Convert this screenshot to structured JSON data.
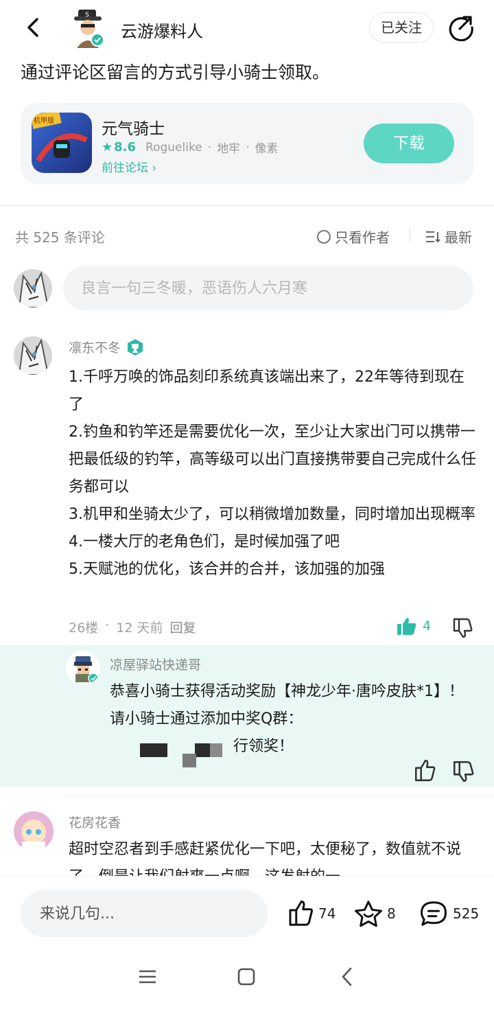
{
  "header": {
    "author_name": "云游爆料人",
    "follow_label": "已关注"
  },
  "post": {
    "text": "通过评论区留言的方式引导小骑士领取。"
  },
  "game_card": {
    "name": "元气骑士",
    "rating": "8.6",
    "tags": [
      "Roguelike",
      "地牢",
      "像素"
    ],
    "forum_link": "前往论坛",
    "download_label": "下载",
    "icon_badge": "机甲版",
    "accent_color": "#2dbba6",
    "download_color": "#5ed6c4"
  },
  "comments_bar": {
    "count_text": "共 525 条评论",
    "only_author_label": "只看作者",
    "sort_label": "最新"
  },
  "comment_input": {
    "placeholder": "良言一句三冬暖，恶语伤人六月寒"
  },
  "comments": [
    {
      "user": "凛东不冬",
      "lines": [
        "1.千呼万唤的饰品刻印系统真该端出来了，22年等待到现在了",
        "2.钓鱼和钓竿还是需要优化一次，至少让大家出门可以携带一把最低级的钓竿，高等级可以出门直接携带要自己完成什么任务都可以",
        "3.机甲和坐骑太少了，可以稍微增加数量，同时增加出现概率",
        "4.一楼大厅的老角色们，是时候加强了吧",
        "5.天赋池的优化，该合并的合并，该加强的加强"
      ],
      "floor": "26楼",
      "time": "12 天前",
      "reply_label": "回复",
      "likes": "4",
      "reply": {
        "user": "凉屋驿站快递哥",
        "text": "恭喜小骑士获得活动奖励【神龙少年·唐吟皮肤*1】！ 请小骑士通过添加中奖Q群：",
        "text_tail": "行领奖！"
      }
    },
    {
      "user": "花房花香",
      "text": "超时空忍者到手感赶紧优化一下吧，太便秘了，数值就不说了，倒是让我们射爽一点啊，这发射的一"
    }
  ],
  "bottom_bar": {
    "input_placeholder": "来说几句...",
    "likes": "74",
    "favorites": "8",
    "comments": "525"
  }
}
